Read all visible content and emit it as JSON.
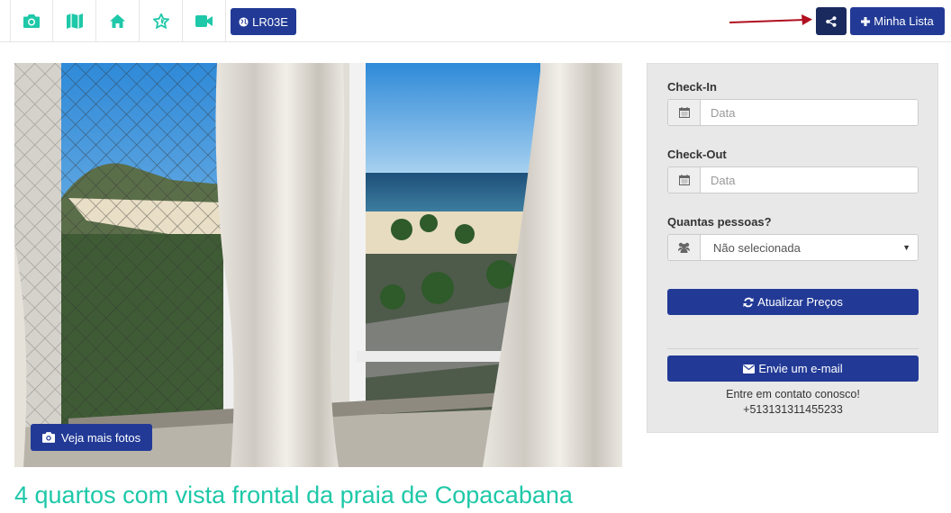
{
  "toolbar": {
    "icons": [
      "camera-icon",
      "map-icon",
      "home-icon",
      "star-icon",
      "video-icon"
    ],
    "code_label": "LR03E",
    "list_label": "Minha Lista"
  },
  "listing": {
    "more_photos_label": "Veja mais fotos",
    "title": "4 quartos com vista frontal da praia de Copacabana"
  },
  "booking": {
    "checkin_label": "Check-In",
    "checkin_placeholder": "Data",
    "checkout_label": "Check-Out",
    "checkout_placeholder": "Data",
    "guests_label": "Quantas pessoas?",
    "guests_value": "Não selecionada",
    "update_prices_label": "Atualizar Preços",
    "email_label": "Envie um e-mail",
    "contact_text": "Entre em contato conosco!",
    "contact_phone": "+513131311455233"
  },
  "colors": {
    "accent": "#1ec8a8",
    "primary": "#223a96",
    "share": "#1a2a5e",
    "arrow": "#b01020"
  }
}
